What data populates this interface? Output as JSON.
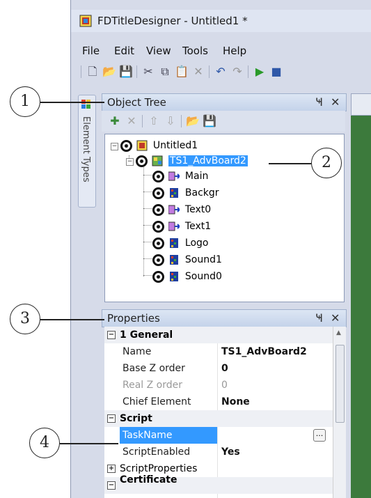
{
  "window": {
    "title": "FDTitleDesigner - Untitled1 *"
  },
  "menu": [
    "File",
    "Edit",
    "View",
    "Tools",
    "Help"
  ],
  "side_tab": {
    "label": "Element Types"
  },
  "object_tree": {
    "title": "Object Tree",
    "root": "Untitled1",
    "selected": "TS1_AdvBoard2",
    "children": [
      "Main",
      "Backgr",
      "Text0",
      "Text1",
      "Logo",
      "Sound1",
      "Sound0"
    ]
  },
  "properties": {
    "title": "Properties",
    "cat1": "1 General",
    "rows1": [
      {
        "name": "Name",
        "value": "TS1_AdvBoard2"
      },
      {
        "name": "Base Z order",
        "value": "0"
      },
      {
        "name": "Real Z order",
        "value": "0"
      },
      {
        "name": "Chief Element",
        "value": "None"
      }
    ],
    "cat2": "Script",
    "rows2": [
      {
        "name": "TaskName",
        "value": ""
      },
      {
        "name": "ScriptEnabled",
        "value": "Yes"
      }
    ],
    "script_props": "ScriptProperties",
    "cat3": "Certificate"
  },
  "callouts": [
    "1",
    "2",
    "3",
    "4"
  ],
  "icons": {
    "pin": "Ҹ",
    "close": "✕",
    "expand": "⊟",
    "collapse": "⊞",
    "ellipsis": "..."
  }
}
